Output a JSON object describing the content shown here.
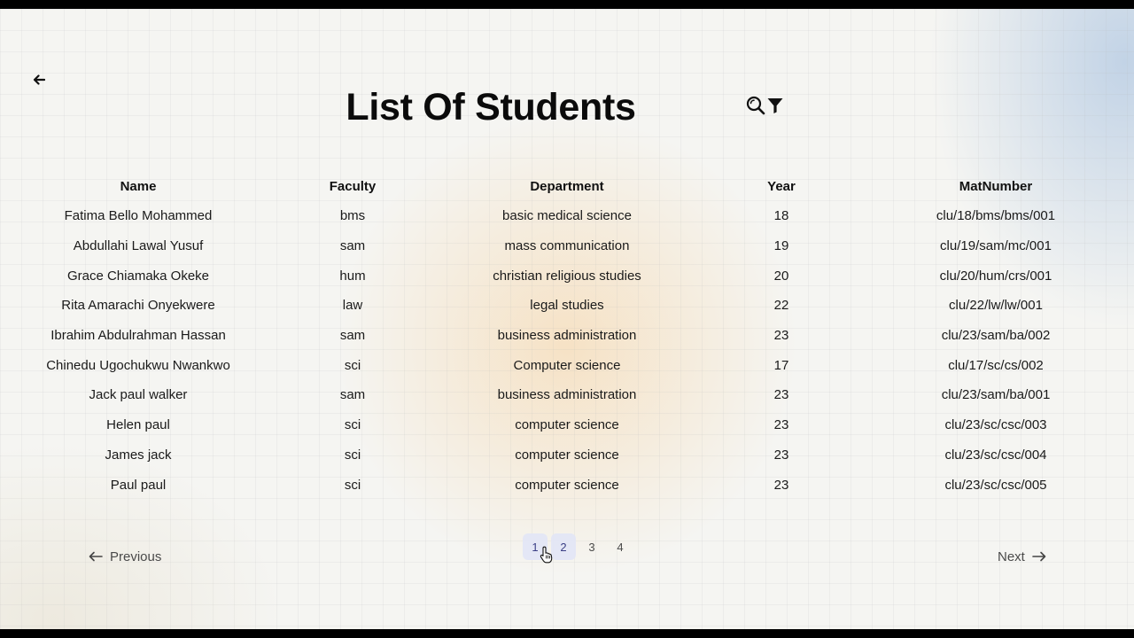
{
  "header": {
    "title": "List Of Students",
    "back_icon": "arrow-left-icon",
    "tools": [
      {
        "name": "search-zoom-icon"
      },
      {
        "name": "filter-icon"
      }
    ]
  },
  "table": {
    "columns": [
      "Name",
      "Faculty",
      "Department",
      "Year",
      "MatNumber"
    ],
    "rows": [
      [
        "Fatima Bello Mohammed",
        "bms",
        "basic medical science",
        "18",
        "clu/18/bms/bms/001"
      ],
      [
        "Abdullahi Lawal Yusuf",
        "sam",
        "mass communication",
        "19",
        "clu/19/sam/mc/001"
      ],
      [
        "Grace Chiamaka Okeke",
        "hum",
        "christian religious studies",
        "20",
        "clu/20/hum/crs/001"
      ],
      [
        "Rita Amarachi Onyekwere",
        "law",
        "legal studies",
        "22",
        "clu/22/lw/lw/001"
      ],
      [
        "Ibrahim Abdulrahman Hassan",
        "sam",
        "business administration",
        "23",
        "clu/23/sam/ba/002"
      ],
      [
        "Chinedu Ugochukwu Nwankwo",
        "sci",
        "Computer science",
        "17",
        "clu/17/sc/cs/002"
      ],
      [
        "Jack paul walker",
        "sam",
        "business administration",
        "23",
        "clu/23/sam/ba/001"
      ],
      [
        "Helen paul",
        "sci",
        "computer science",
        "23",
        "clu/23/sc/csc/003"
      ],
      [
        "James jack",
        "sci",
        "computer science",
        "23",
        "clu/23/sc/csc/004"
      ],
      [
        "Paul paul",
        "sci",
        "computer science",
        "23",
        "clu/23/sc/csc/005"
      ]
    ]
  },
  "pagination": {
    "previous_label": "Previous",
    "next_label": "Next",
    "pages": [
      "1",
      "2",
      "3",
      "4"
    ],
    "current_page": "1"
  },
  "colors": {
    "active_page_bg": "#e2e6f6",
    "active_page_text": "#3b3f86"
  }
}
